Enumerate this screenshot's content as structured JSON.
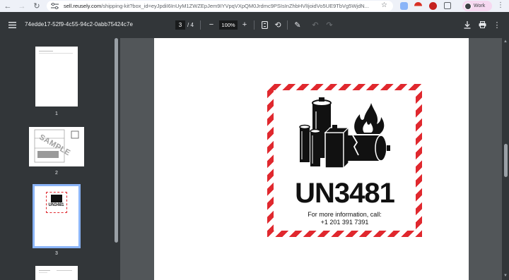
{
  "browser": {
    "url_host": "sell.reusely.com",
    "url_rest": "/shipping-kit?box_id=eyJpdiI6InUyM1ZWZEpJem9IYVpqVXpQM0Jrdmc9PSIsInZhbHVlIjoidVo5UE9TbVg5WjdN...",
    "profile_label": "Work"
  },
  "toolbar": {
    "doc_title": "74edde17-52f9-4c55-94c2-0abb75424c7e",
    "current_page": "3",
    "page_of": "/ 4",
    "zoom": "100%"
  },
  "thumbnails": [
    {
      "label": "1"
    },
    {
      "label": "2",
      "stamp": "SAMPLE"
    },
    {
      "label": "3",
      "mini_code": "UN3481"
    },
    {
      "label": ""
    }
  ],
  "label": {
    "code": "UN3481",
    "info_line1": "For more information, call:",
    "info_line2": "+1 201 391 7391",
    "stripe_color": "#e0282e"
  }
}
